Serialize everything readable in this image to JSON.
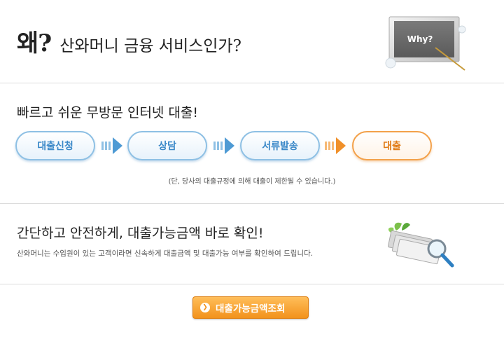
{
  "section1": {
    "title_big": "왜?",
    "title_rest": "산와머니 금융 서비스인가?",
    "board_text": "Why?",
    "board_icon": "chalkboard-why-icon"
  },
  "section2": {
    "title": "빠르고 쉬운 무방문 인터넷 대출!",
    "steps": [
      {
        "label": "대출신청"
      },
      {
        "label": "상담"
      },
      {
        "label": "서류발송"
      },
      {
        "label": "대출"
      }
    ],
    "note": "(단, 당사의 대출규정에 의해 대출이 제한될 수 있습니다.)",
    "colors": {
      "blue": "#3a88c8",
      "orange": "#e07a14"
    }
  },
  "section3": {
    "title": "간단하고 안전하게, 대출가능금액 바로 확인!",
    "description": "산와머니는 수입원이 있는 고객이라면 신속하게 대출금액 및 대출가능 여부를 확인하여 드립니다.",
    "illustration_icon": "money-magnifier-icon"
  },
  "cta": {
    "label": "대출가능금액조회",
    "icon": "arrow-circle-icon",
    "color": "#f2921c"
  }
}
